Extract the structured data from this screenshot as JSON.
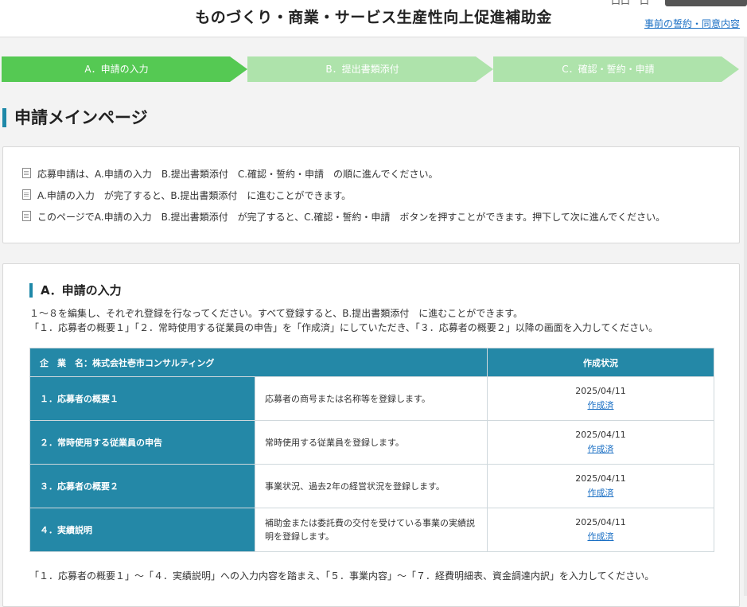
{
  "header": {
    "title": "ものづくり・商業・サービス生産性向上促進補助金",
    "top_small": "口口　口",
    "oath_link": "事前の誓約・同意内容"
  },
  "steps": [
    {
      "label": "A．申請の入力",
      "state": "active"
    },
    {
      "label": "B．提出書類添付",
      "state": "inactive"
    },
    {
      "label": "C．確認・誓約・申請",
      "state": "inactive"
    }
  ],
  "colors": {
    "step_active": "#55c953",
    "step_inactive": "#aee3ab",
    "table_header": "#2488a7",
    "link": "#1a6fc4"
  },
  "page_title": "申請メインページ",
  "info": [
    "応募申請は、A.申請の入力　B.提出書類添付　C.確認・誓約・申請　の順に進んでください。",
    "A.申請の入力　が完了すると、B.提出書類添付　に進むことができます。",
    "このページでA.申請の入力　B.提出書類添付　が完了すると、C.確認・誓約・申請　ボタンを押すことができます。押下して次に進んでください。"
  ],
  "section": {
    "title": "A．申請の入力",
    "desc1": "１～８を編集し、それぞれ登録を行なってください。すべて登録すると、B.提出書類添付　に進むことができます。",
    "desc2": "「１．応募者の概要１」「２．常時使用する従業員の申告」を「作成済」にしていただき、「３．応募者の概要２」以降の画面を入力してください。",
    "company_header": "企　業　名：株式会社壱市コンサルティング",
    "status_header": "作成状況",
    "rows": [
      {
        "item": "１．応募者の概要１",
        "desc": "応募者の商号または名称等を登録します。",
        "date": "2025/04/11",
        "status": "作成済"
      },
      {
        "item": "２．常時使用する従業員の申告",
        "desc": "常時使用する従業員を登録します。",
        "date": "2025/04/11",
        "status": "作成済"
      },
      {
        "item": "３．応募者の概要２",
        "desc": "事業状況、過去2年の経営状況を登録します。",
        "date": "2025/04/11",
        "status": "作成済"
      },
      {
        "item": "４．実績説明",
        "desc": "補助金または委託費の交付を受けている事業の実績説明を登録します。",
        "date": "2025/04/11",
        "status": "作成済"
      }
    ],
    "footer_note": "「１．応募者の概要１」～「４．実績説明」への入力内容を踏まえ、「５．事業内容」～「７．経費明細表、資金調達内訳」を入力してください。"
  }
}
